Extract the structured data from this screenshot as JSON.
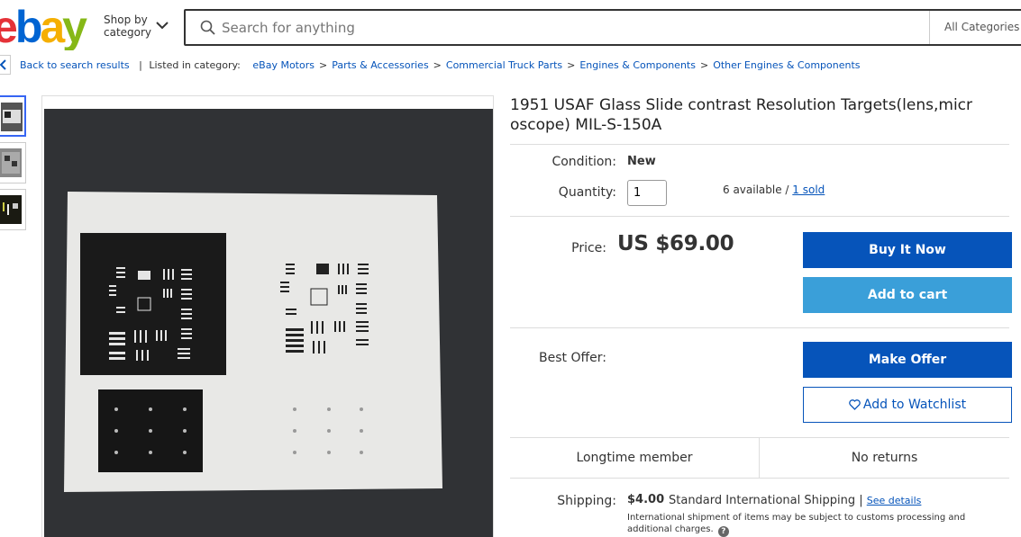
{
  "header": {
    "logo_letters": [
      "e",
      "b",
      "a",
      "y"
    ],
    "logo_colors": [
      "#e53238",
      "#0064d2",
      "#f5af02",
      "#86b817"
    ],
    "shop_by_line1": "Shop by",
    "shop_by_line2": "category",
    "search_placeholder": "Search for anything",
    "category_selected": "All Categories"
  },
  "breadcrumb": {
    "back_label": "Back to search results",
    "listed_in": "Listed in category:",
    "items": [
      "eBay Motors",
      "Parts & Accessories",
      "Commercial Truck Parts",
      "Engines & Components",
      "Other Engines & Components"
    ]
  },
  "gallery": {
    "thumbnails": [
      "thumbnail-1",
      "thumbnail-2",
      "thumbnail-3"
    ],
    "selected_index": 0
  },
  "listing": {
    "title": "1951 USAF Glass Slide contrast Resolution Targets(lens,microscope) MIL-S-150A",
    "condition_label": "Condition:",
    "condition_value": "New",
    "quantity_label": "Quantity:",
    "quantity_value": "1",
    "available_text": "6 available / ",
    "sold_text": "1 sold",
    "price_label": "Price:",
    "price_value": "US $69.00",
    "buy_now_label": "Buy It Now",
    "add_to_cart_label": "Add to cart",
    "best_offer_label": "Best Offer:",
    "make_offer_label": "Make Offer",
    "watchlist_label": "Add to Watchlist",
    "badge_left": "Longtime member",
    "badge_right": "No returns",
    "shipping_label": "Shipping:",
    "shipping_price": "$4.00",
    "shipping_method": "Standard International Shipping | ",
    "see_details": "See details",
    "shipping_note": "International shipment of items may be subject to customs processing and additional charges."
  },
  "colors": {
    "primary_blue": "#0654ba",
    "light_blue": "#3a9fd9",
    "link_blue": "#0654ba"
  }
}
